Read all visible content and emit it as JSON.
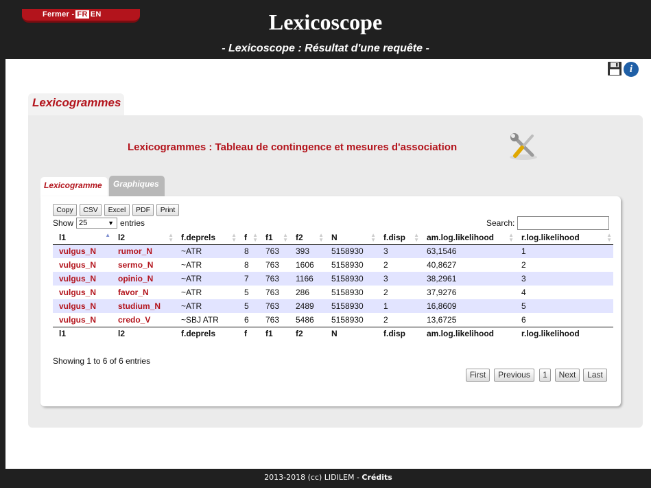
{
  "header": {
    "close_label": "Fermer -",
    "lang_fr": "FR",
    "lang_en": "EN",
    "title": "Lexicoscope",
    "subtitle": "- Lexicoscope : Résultat d'une requête -"
  },
  "tabs": {
    "outer": "Lexicogrammes",
    "inner": [
      "Lexicogramme",
      "Graphiques"
    ]
  },
  "panel_title": "Lexicogrammes : Tableau de contingence et mesures d'association",
  "export_buttons": [
    "Copy",
    "CSV",
    "Excel",
    "PDF",
    "Print"
  ],
  "length_menu": {
    "show": "Show",
    "value": "25",
    "entries": "entries"
  },
  "search_label": "Search:",
  "table": {
    "columns": [
      "l1",
      "l2",
      "f.deprels",
      "f",
      "f1",
      "f2",
      "N",
      "f.disp",
      "am.log.likelihood",
      "r.log.likelihood"
    ],
    "rows": [
      [
        "vulgus_N",
        "rumor_N",
        "~ATR",
        "8",
        "763",
        "393",
        "5158930",
        "3",
        "63,1546",
        "1"
      ],
      [
        "vulgus_N",
        "sermo_N",
        "~ATR",
        "8",
        "763",
        "1606",
        "5158930",
        "2",
        "40,8627",
        "2"
      ],
      [
        "vulgus_N",
        "opinio_N",
        "~ATR",
        "7",
        "763",
        "1166",
        "5158930",
        "3",
        "38,2961",
        "3"
      ],
      [
        "vulgus_N",
        "favor_N",
        "~ATR",
        "5",
        "763",
        "286",
        "5158930",
        "2",
        "37,9276",
        "4"
      ],
      [
        "vulgus_N",
        "studium_N",
        "~ATR",
        "5",
        "763",
        "2489",
        "5158930",
        "1",
        "16,8609",
        "5"
      ],
      [
        "vulgus_N",
        "credo_V",
        "~SBJ ATR",
        "6",
        "763",
        "5486",
        "5158930",
        "2",
        "13,6725",
        "6"
      ]
    ]
  },
  "info_text": "Showing 1 to 6 of 6 entries",
  "pagination": [
    "First",
    "Previous",
    "1",
    "Next",
    "Last"
  ],
  "footer": {
    "text": "2013-2018 (cc) LIDILEM -",
    "credits": "Crédits"
  },
  "colors": {
    "accent": "#b3141c",
    "bar": "#202020",
    "odd_row": "#e2e4ff"
  }
}
